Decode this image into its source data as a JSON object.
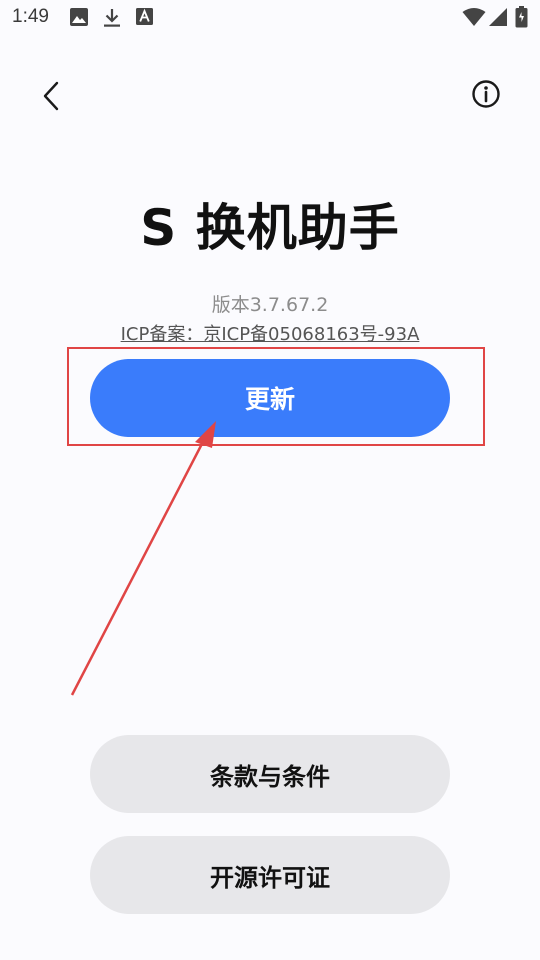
{
  "status_bar": {
    "time": "1:49",
    "icons": [
      "image-icon",
      "download-icon",
      "font-icon",
      "wifi-icon",
      "signal-icon",
      "battery-icon"
    ]
  },
  "header": {
    "back_icon": "chevron-left-icon",
    "info_icon": "info-icon"
  },
  "app": {
    "title": "S 换机助手",
    "version": "版本3.7.67.2",
    "icp": "ICP备案：京ICP备05068163号-93A"
  },
  "actions": {
    "update_label": "更新",
    "terms_label": "条款与条件",
    "license_label": "开源许可证"
  },
  "colors": {
    "primary": "#3a7cfb",
    "secondary_button": "#e7e7ea",
    "annotation": "#e04545",
    "background": "#fbfbfe"
  }
}
